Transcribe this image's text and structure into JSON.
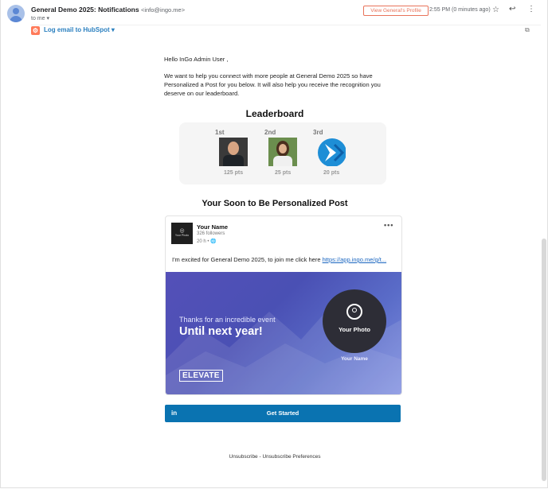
{
  "header": {
    "subject": "General Demo 2025: Notifications",
    "sender_email": "<info@ingo.me>",
    "to_label": "to me",
    "view_profile_label": "View General's Profile",
    "time": "2:55 PM (0 minutes ago)"
  },
  "hubspot": {
    "label": "Log email to HubSpot"
  },
  "body": {
    "greeting": "Hello InGo Admin User ,",
    "paragraph": "We want to help you connect with more people at General Demo 2025 so have Personalized a Post for you below. It will also help you receive the recognition you deserve on our leaderboard."
  },
  "leaderboard": {
    "title": "Leaderboard",
    "entries": [
      {
        "rank": "1st",
        "points": "125 pts"
      },
      {
        "rank": "2nd",
        "points": "25 pts"
      },
      {
        "rank": "3rd",
        "points": "20 pts"
      }
    ]
  },
  "post": {
    "section_title": "Your Soon to Be Personalized Post",
    "avatar_text": "Your Photo",
    "name": "Your Name",
    "followers": "326 followers",
    "time": "20 h •",
    "text": "I'm excited for General Demo 2025, to join me click here ",
    "link": "https://app.ingo.me/g/t...",
    "banner": {
      "line1": "Thanks for an incredible event",
      "line2": "Until next year!",
      "photo_label": "Your Photo",
      "name_label": "Your Name",
      "brand": "ELEVATE"
    }
  },
  "cta": {
    "icon_text": "in",
    "label": "Get Started"
  },
  "footer": {
    "unsubscribe": "Unsubscribe",
    "separator": " - ",
    "preferences": "Unsubscribe Preferences"
  },
  "colors": {
    "hubspot": "#ff7a59",
    "link": "#1a66c0",
    "cta": "#0a73b1",
    "banner": "#5450b8"
  }
}
